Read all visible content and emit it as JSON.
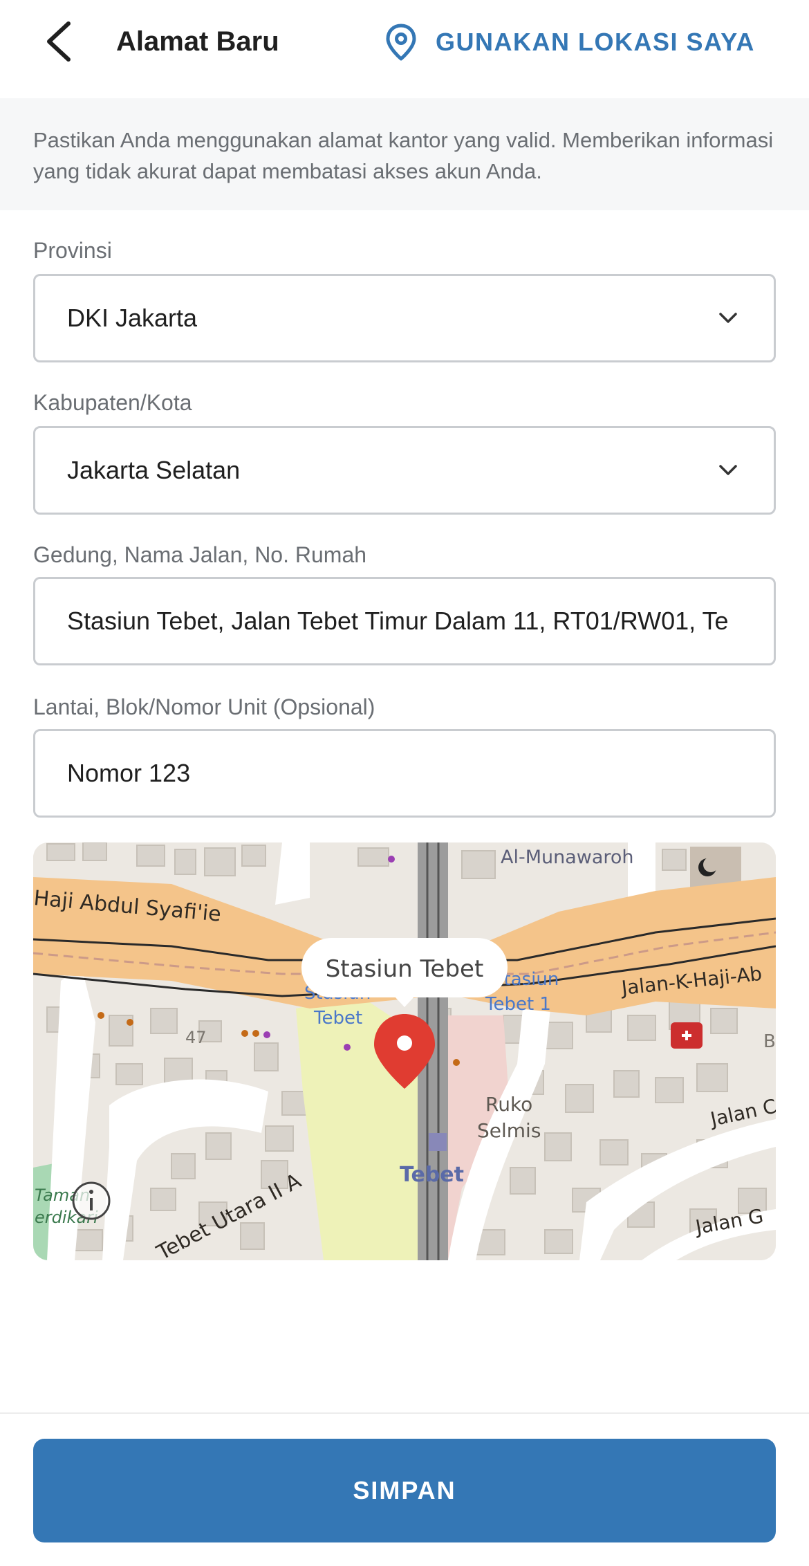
{
  "header": {
    "title": "Alamat Baru",
    "use_location_label": "GUNAKAN LOKASI SAYA",
    "accent_color": "#3477b5"
  },
  "notice": {
    "text": "Pastikan Anda menggunakan alamat kantor yang valid. Memberikan informasi yang tidak akurat dapat membatasi akses akun Anda."
  },
  "form": {
    "province": {
      "label": "Provinsi",
      "value": "DKI Jakarta"
    },
    "city": {
      "label": "Kabupaten/Kota",
      "value": "Jakarta Selatan"
    },
    "street": {
      "label": "Gedung, Nama Jalan, No. Rumah",
      "value": "Stasiun Tebet, Jalan Tebet Timur Dalam 11, RT01/RW01, Te"
    },
    "unit": {
      "label": "Lantai, Blok/Nomor Unit (Opsional)",
      "value": "Nomor 123"
    }
  },
  "map": {
    "callout": "Stasiun Tebet",
    "labels": {
      "al_munawaroh": "Al-Munawaroh",
      "haji_abdul": "Haji Abdul Syafi'ie",
      "jalan_kh": "Jalan-K-Haji-Ab",
      "stasiun_tebet_l1": "Stasiun",
      "stasiun_tebet_l2": "Tebet",
      "stasiun_tebet1_l1": "Stasiun",
      "stasiun_tebet1_l2": "Tebet 1",
      "num_47": "47",
      "ruko_l1": "Ruko",
      "ruko_l2": "Selmis",
      "tebet": "Tebet",
      "jalan_c": "Jalan C",
      "jalan_g": "Jalan G",
      "tebet_utara": "Tebet Utara II A",
      "taman_l1": "Taman",
      "taman_l2": "erdikari",
      "edge_b": "B"
    },
    "pin_color": "#e03c31"
  },
  "footer": {
    "save_label": "SIMPAN"
  }
}
